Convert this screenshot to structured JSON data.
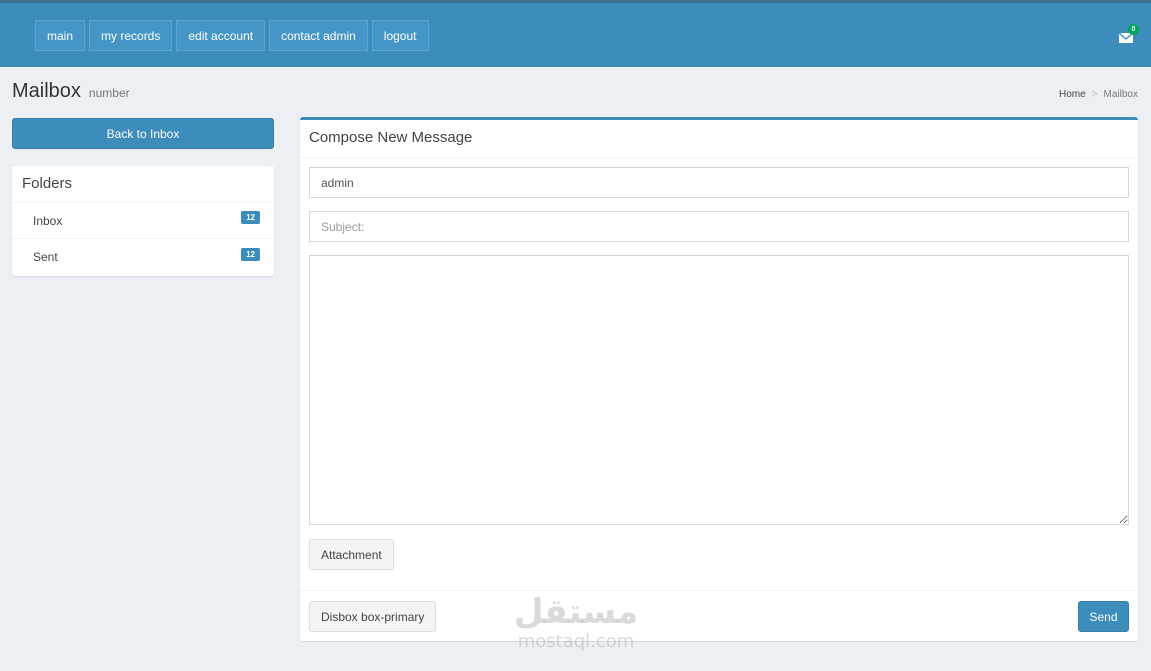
{
  "nav": {
    "buttons": [
      "main",
      "my records",
      "edit account",
      "contact admin",
      "logout"
    ],
    "mail_count": "0"
  },
  "header": {
    "title": "Mailbox",
    "subtitle": "number",
    "breadcrumb": {
      "home": "Home",
      "separator": ">",
      "current": "Mailbox"
    }
  },
  "sidebar": {
    "back_label": "Back to Inbox",
    "folders_title": "Folders",
    "folders": [
      {
        "label": "Inbox",
        "count": "12"
      },
      {
        "label": "Sent",
        "count": "12"
      }
    ]
  },
  "compose": {
    "title": "Compose New Message",
    "to_value": "admin",
    "subject_placeholder": "Subject:",
    "body_value": "",
    "attachment_label": "Attachment",
    "discard_label": "Disbox box-primary",
    "send_label": "Send"
  },
  "watermark": {
    "arabic": "مستقل",
    "latin": "mostaql.com"
  },
  "colors": {
    "primary": "#3c8dbc",
    "background": "#ecf0f5",
    "badge_green": "#00a65a"
  }
}
